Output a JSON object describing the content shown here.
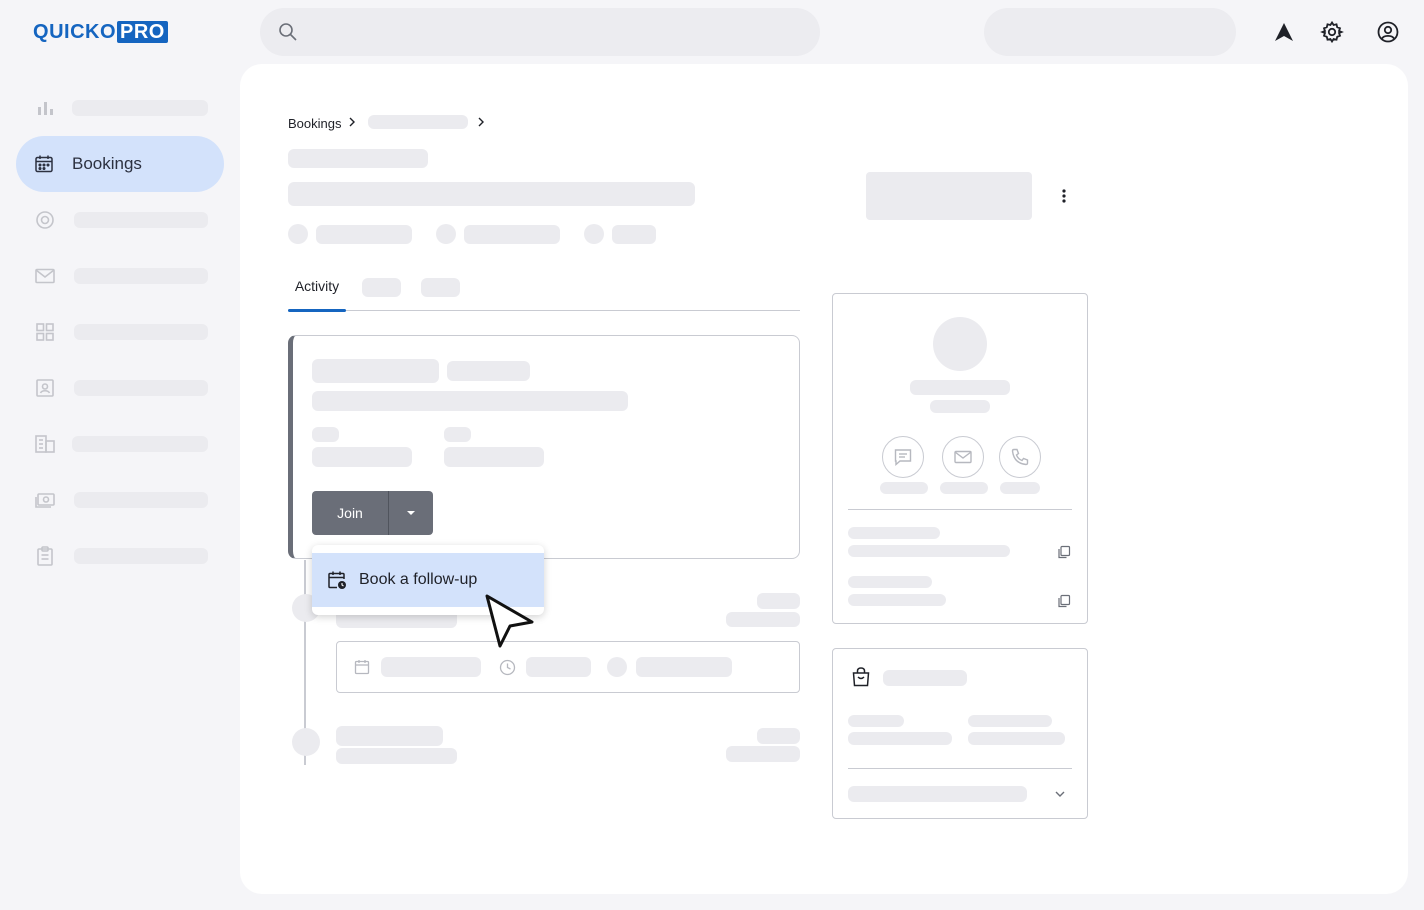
{
  "header": {
    "logo": {
      "q": "Q",
      "main": "UICKO",
      "pro": "PRO"
    },
    "search_placeholder": ""
  },
  "sidebar": {
    "active_item": "Bookings",
    "icons": [
      "chart-icon",
      "calendar-icon",
      "target-icon",
      "mail-icon",
      "grid-icon",
      "contact-icon",
      "building-icon",
      "money-icon",
      "clipboard-icon"
    ]
  },
  "breadcrumb": {
    "root": "Bookings"
  },
  "tabs": {
    "active": "Activity"
  },
  "booking_card": {
    "join_label": "Join"
  },
  "dropdown": {
    "item_label": "Book a follow-up"
  },
  "colors": {
    "brand": "#1565c0",
    "active_nav_bg": "#d3e2fb",
    "button_bg": "#6a6e78",
    "skeleton": "#ebebef"
  }
}
